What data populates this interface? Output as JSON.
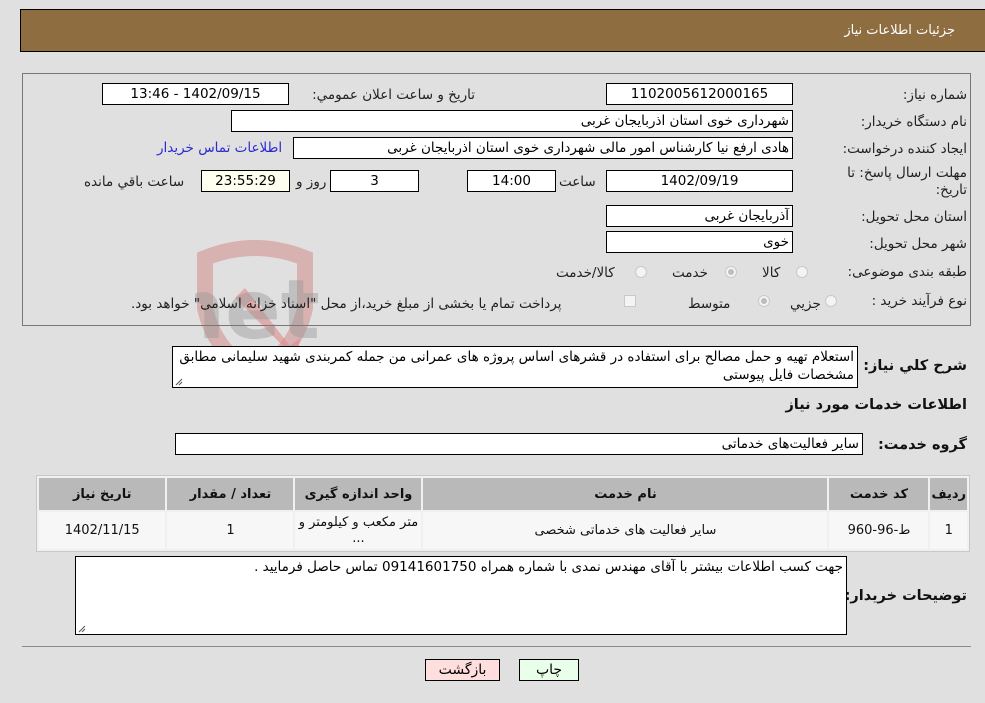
{
  "header": {
    "title": "جزئیات اطلاعات نیاز"
  },
  "form": {
    "need_number": {
      "label": "شماره نیاز:",
      "value": "1102005612000165"
    },
    "announce": {
      "label": "تاریخ و ساعت اعلان عمومي:",
      "value": "1402/09/15 - 13:46"
    },
    "buyer_org": {
      "label": "نام دستگاه خریدار:",
      "value": "شهرداری خوی استان اذربایجان غربی"
    },
    "requester": {
      "label": "ایجاد کننده درخواست:",
      "value": "هادی ارفع نیا کارشناس امور مالی شهرداری خوی استان اذربایجان غربی"
    },
    "buyer_contact_link": "اطلاعات تماس خریدار",
    "deadline": {
      "label_line1": "مهلت ارسال پاسخ: تا",
      "label_line2": "تاریخ:",
      "date": "1402/09/19",
      "time_label": "ساعت",
      "time": "14:00",
      "days": "3",
      "days_label": "روز و",
      "remaining": "23:55:29",
      "remaining_label": "ساعت باقي مانده"
    },
    "province": {
      "label": "استان محل تحویل:",
      "value": "آذربایجان غربی"
    },
    "city": {
      "label": "شهر محل تحویل:",
      "value": "خوی"
    },
    "category": {
      "label": "طبقه بندی موضوعی:",
      "options": [
        {
          "label": "کالا",
          "checked": false
        },
        {
          "label": "خدمت",
          "checked": true
        },
        {
          "label": "کالا/خدمت",
          "checked": false
        }
      ]
    },
    "process": {
      "label": "نوع فرآیند خرید :",
      "options": [
        {
          "label": "جزيي",
          "checked": false
        },
        {
          "label": "متوسط",
          "checked": true
        }
      ],
      "checkbox_label": "پرداخت تمام یا بخشی از مبلغ خرید،از محل \"اسناد خزانه اسلامی\" خواهد بود.",
      "checkbox_checked": false
    }
  },
  "description": {
    "label": "شرح کلي نیاز:",
    "value": "استعلام تهیه و حمل مصالح برای استفاده در قشرهای اساس پروژه های عمرانی من جمله کمربندی شهید سلیمانی مطابق مشخصات فایل پیوستی"
  },
  "services_title": "اطلاعات خدمات مورد نیاز",
  "service_group": {
    "label": "گروه خدمت:",
    "value": "سایر فعالیت‌های خدماتی"
  },
  "table": {
    "headers": [
      "ردیف",
      "کد خدمت",
      "نام خدمت",
      "واحد اندازه گیری",
      "تعداد / مقدار",
      "تاریخ نیاز"
    ],
    "rows": [
      [
        "1",
        "ط-96-960",
        "سایر فعالیت های خدماتی شخصی",
        "متر مکعب و کیلومتر و ...",
        "1",
        "1402/11/15"
      ]
    ]
  },
  "buyer_notes": {
    "label": "توضیحات خریدار:",
    "value": "جهت کسب اطلاعات بیشتر با آقای مهندس نمدی با شماره همراه 09141601750 تماس حاصل فرمایید ."
  },
  "buttons": {
    "print": "چاپ",
    "back": "بازگشت"
  },
  "watermark": {
    "text": "AriaTender.net"
  },
  "colors": {
    "header_bg": "#8e6d41",
    "print_bg": "#eaffea",
    "back_bg": "#ffdede",
    "link": "#2a2ad0"
  }
}
